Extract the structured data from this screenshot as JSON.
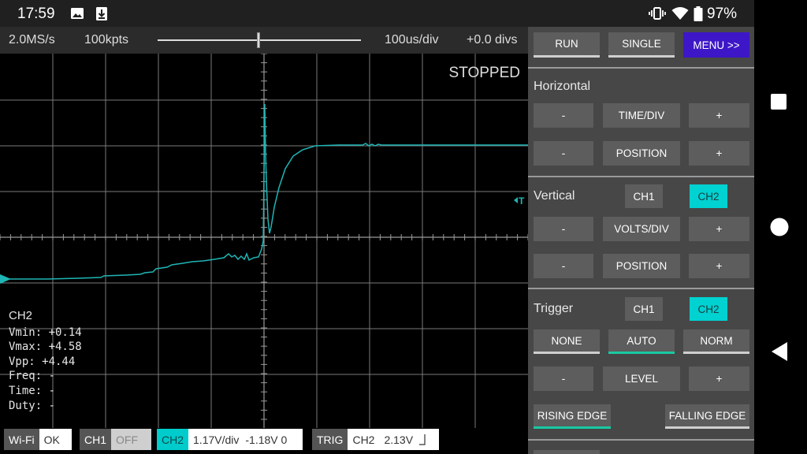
{
  "status_bar": {
    "time": "17:59",
    "battery": "97%",
    "icons": [
      "image-icon",
      "download-icon",
      "vibrate-icon",
      "wifi-icon",
      "battery-icon"
    ]
  },
  "scope_bar": {
    "sample_rate": "2.0MS/s",
    "points": "100kpts",
    "timebase": "100us/div",
    "offset": "+0.0 divs"
  },
  "screen": {
    "state": "STOPPED",
    "trigger_marker": "T",
    "measurements": {
      "channel": "CH2",
      "vmin": "Vmin: +0.14",
      "vmax": "Vmax: +4.58",
      "vpp": "Vpp: +4.44",
      "freq": "Freq: -",
      "time": "Time: -",
      "duty": "Duty: -"
    },
    "trace_color": "#1fb5b5"
  },
  "bottom_bar": {
    "wifi_key": "Wi-Fi",
    "wifi_val": "OK",
    "ch1_key": "CH1",
    "ch1_val": "OFF",
    "ch2_key": "CH2",
    "ch2_scale": "1.17V/div",
    "ch2_offset": "-1.18V 0",
    "trig_key": "TRIG",
    "trig_ch": "CH2",
    "trig_level": "2.13V"
  },
  "panel": {
    "run": "RUN",
    "single": "SINGLE",
    "menu": "MENU >>",
    "horizontal_label": "Horizontal",
    "time_div": "TIME/DIV",
    "position": "POSITION",
    "minus": "-",
    "plus": "+",
    "vertical_label": "Vertical",
    "ch1": "CH1",
    "ch2": "CH2",
    "volts_div": "VOLTS/DIV",
    "trigger_label": "Trigger",
    "none": "NONE",
    "auto": "AUTO",
    "norm": "NORM",
    "level": "LEVEL",
    "rising": "RISING EDGE",
    "falling": "FALLING EDGE"
  },
  "colors": {
    "accent_cyan": "#00d1d1",
    "menu_purple": "#3d17c7",
    "active_underline": "#19c9a3"
  }
}
